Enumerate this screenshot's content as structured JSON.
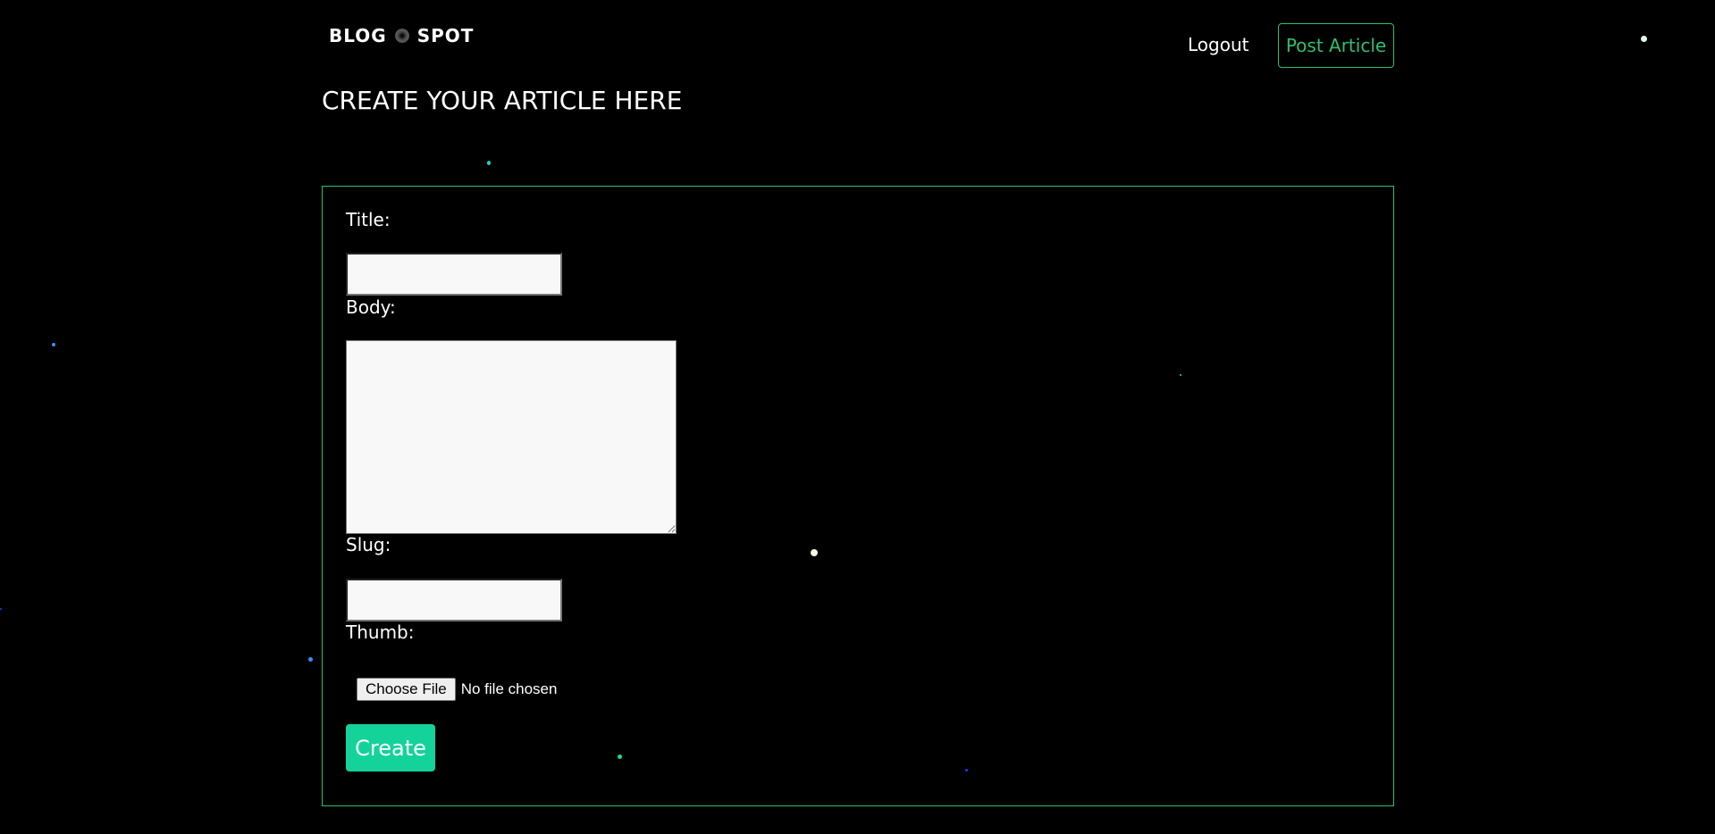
{
  "header": {
    "logo_left": "BLOG",
    "logo_right": "SPOT",
    "logout_label": "Logout",
    "post_article_label": "Post Article"
  },
  "page_title": "CREATE YOUR ARTICLE HERE",
  "form": {
    "title_label": "Title:",
    "title_value": "",
    "body_label": "Body:",
    "body_value": "",
    "slug_label": "Slug:",
    "slug_value": "",
    "thumb_label": "Thumb:",
    "choose_file_label": "Choose File",
    "file_status": "No file chosen",
    "create_label": "Create"
  },
  "colors": {
    "background": "#000000",
    "accent_green": "#2fbf71",
    "create_button": "#13d39a"
  }
}
